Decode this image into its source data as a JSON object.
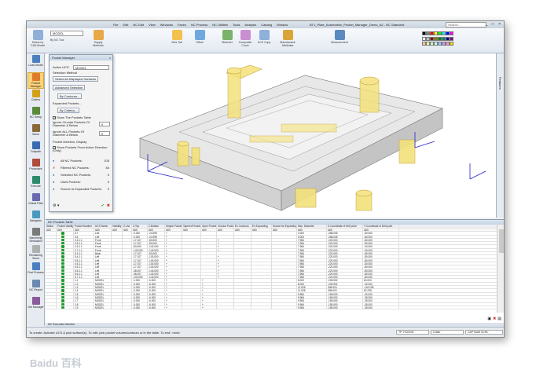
{
  "app": {
    "title": "BT1_Plate_Automation_Pocket_Manager_Demo_A2 - NC Standard",
    "menu": [
      "File",
      "Edit",
      "NC Edit",
      "View",
      "Windows",
      "Faces",
      "NC Process",
      "NC Utilities",
      "Tools",
      "Analysis",
      "Catalog",
      "Window"
    ],
    "search_placeholder": "Search...",
    "window_buttons": "_ □ ×",
    "model_combo": "MODEL"
  },
  "ribbon": {
    "select_by": "Select by\nCAD Model",
    "by_nc_tool": "By NC Tool",
    "supply_methods": "Supply Methods",
    "sets_tab": "Sets Tab",
    "offset": "Offset",
    "sketcher": "Sketcher",
    "composite_curve": "Composite Curve",
    "ucs_copy": "UCS Copy",
    "manufacture_attributes": "Manufacture Attributes",
    "measurement": "Measurement",
    "swatch_colors": [
      "#000000",
      "#7f7f7f",
      "#ff0000",
      "#ffff00",
      "#00ff00",
      "#00ffff",
      "#0000ff",
      "#ff00ff",
      "#ffffff",
      "#c0c0c0",
      "#800000",
      "#808000",
      "#008000",
      "#008080",
      "#000080",
      "#800080",
      "#ffcc99",
      "#ffff99",
      "#ccffcc",
      "#ccffff",
      "#99ccff",
      "#cc99ff",
      "#ff99cc",
      "#ffd700"
    ]
  },
  "left_toolbar": [
    {
      "label": "Load Model",
      "color": "#4a7fc0"
    },
    {
      "label": "Pocket Manager",
      "color": "#e07b2a",
      "active": true
    },
    {
      "label": "Cutters",
      "color": "#d4a017"
    },
    {
      "label": "NC Setup",
      "color": "#5a8a3a"
    },
    {
      "label": "Stock",
      "color": "#8a6a3a"
    },
    {
      "label": "Toolpath",
      "color": "#3a6ab0"
    },
    {
      "label": "Procedure",
      "color": "#b04a3a"
    },
    {
      "label": "Execute",
      "color": "#2a8a6a"
    },
    {
      "label": "Global Filter",
      "color": "#6a6ab0"
    },
    {
      "label": "Navigator",
      "color": "#4a9ac0"
    },
    {
      "label": "Machining Simulation",
      "color": "#7a7a7a"
    },
    {
      "label": "Remaining Stock",
      "color": "#b0b0b0"
    },
    {
      "label": "Post Process",
      "color": "#4a7fc0"
    },
    {
      "label": "NC Report",
      "color": "#6a8ab0"
    },
    {
      "label": "Job Manager",
      "color": "#8a5a9a"
    }
  ],
  "right_strip_label": "Features",
  "pocket_manager": {
    "title": "Pocket Manager",
    "active_ucs_label": "Active UCS:",
    "active_ucs_value": "MODEL",
    "selection_method": "Selection Method",
    "select_all_button": "Select All Displayed Surfaces",
    "advanced_button": "Advanced Selection",
    "by_contours_button": "By Contours...",
    "expanded_pockets": "Expanded Pockets...",
    "by_criteria_button": "By Criteria...",
    "show_pockets_table": "Show The Pockets Table",
    "ignore_circular": "Ignore Circular Pockets Of Diameter & Below",
    "ignore_circular_value": "0",
    "ignore_all": "Ignore ALL Pockets Of Diameter & Below",
    "ignore_all_value": "5",
    "pocket_deletion": "Pocket Deletion, Display",
    "show_from_direction": "Show Pockets From Active Direction (Only)",
    "counts": [
      {
        "label": "All NC Pockets:",
        "value": "105"
      },
      {
        "label": "Filtered NC Pockets:",
        "value": "84"
      },
      {
        "label": "Selected NC Pockets:",
        "value": "0"
      },
      {
        "label": "Used Pockets:",
        "value": "0"
      },
      {
        "label": "Source to Expanded Pockets:",
        "value": "0"
      }
    ]
  },
  "nc_table": {
    "title": "NC Pockets Table",
    "columns": [
      "Status",
      "Pocket Validity",
      "Pocket Number",
      "UCS Name",
      "Visibility",
      "Z-List",
      "Z-Top",
      "Z-Bottom",
      "Simple Pocket",
      "Tapered Pocket",
      "Open Pocket",
      "Circular Pocket",
      "Ex Contours",
      "Ex Expanding",
      "Source for Expanding",
      "Max. Diameter",
      "X-Coordinate of Drill point",
      "Y-Coordinate of Drill point"
    ],
    "filter": "(All)",
    "rows": [
      [
        "5.7",
        "Left",
        "",
        "",
        "-0.000",
        "-24.995",
        "+",
        "",
        "",
        "",
        "",
        "",
        "",
        "3.000",
        "-288.005",
        "-80.000"
      ],
      [
        "3.6",
        "Left",
        "",
        "",
        "-0.000",
        "-24.995",
        "+",
        "",
        "",
        "",
        "",
        "",
        "",
        "3.000",
        "-288.005",
        "-80.000"
      ],
      [
        "2.4.1.1",
        "Front",
        "",
        "",
        "-17.107",
        "-83.000",
        "+",
        "",
        "",
        "+",
        "",
        "",
        "",
        "7.984",
        "-220.000",
        "-80.000"
      ],
      [
        "2.5.1.1",
        "Front",
        "",
        "",
        "-17.107",
        "-83.000",
        "+",
        "",
        "",
        "+",
        "",
        "",
        "",
        "7.984",
        "-220.000",
        "-80.000"
      ],
      [
        "2.6.1.1",
        "Front",
        "",
        "",
        "-83.000",
        "-143.000",
        "+",
        "",
        "",
        "+",
        "",
        "",
        "",
        "7.984",
        "-220.000",
        "-30.000"
      ],
      [
        "2.7.1.1",
        "Front",
        "",
        "",
        "-143.000",
        "-143.000",
        "+",
        "",
        "",
        "+",
        "",
        "",
        "",
        "7.984",
        "-220.000",
        "-30.000"
      ],
      [
        "5.3.1.1",
        "Back",
        "",
        "",
        "-17.107",
        "-83.000",
        "+",
        "",
        "",
        "",
        "",
        "",
        "",
        "7.984",
        "-220.000",
        "-80.000"
      ],
      [
        "5.4.1.1",
        "Left",
        "",
        "",
        "-17.107",
        "-103.000",
        "+",
        "",
        "",
        "+",
        "",
        "",
        "",
        "7.984",
        "-220.000",
        "-80.000"
      ],
      [
        "5.5.1.1",
        "Left",
        "",
        "",
        "-17.107",
        "-103.000",
        "+",
        "",
        "",
        "+",
        "",
        "",
        "",
        "7.984",
        "-220.000",
        "-80.000"
      ],
      [
        "4.5.1.1",
        "Left",
        "",
        "",
        "-17.107",
        "-103.000",
        "+",
        "",
        "",
        "+",
        "",
        "",
        "",
        "7.984",
        "-220.000",
        "-80.000"
      ],
      [
        "6.5.1.1",
        "Left",
        "",
        "",
        "-17.107",
        "-103.000",
        "+",
        "",
        "",
        "+",
        "",
        "",
        "",
        "7.984",
        "-220.000",
        "-80.000"
      ],
      [
        "6.5.1.1",
        "Left",
        "",
        "",
        "-36.007",
        "-143.000",
        "+",
        "",
        "",
        "+",
        "",
        "",
        "",
        "7.984",
        "-220.000",
        "-80.000"
      ],
      [
        "6.6.1.1",
        "Left",
        "",
        "",
        "-36.007",
        "-143.000",
        "+",
        "",
        "",
        "+",
        "",
        "",
        "",
        "7.984",
        "-220.000",
        "-80.000"
      ],
      [
        "6.7.1.1",
        "Left",
        "",
        "",
        "-103.000",
        "-143.000",
        "+",
        "",
        "",
        "+",
        "",
        "",
        "",
        "7.984",
        "-220.000",
        "-80.000"
      ],
      [
        "1.1",
        "MODEL",
        "",
        "",
        "-0.000",
        "-6.000",
        "+",
        "",
        "+",
        "",
        "",
        "",
        "",
        "8.002",
        "-205.902",
        "60.000"
      ],
      [
        "1.2",
        "MODEL",
        "",
        "",
        "-0.000",
        "-6.000",
        "+",
        "",
        "+",
        "",
        "",
        "",
        "",
        "8.002",
        "-205.902",
        "-40.000"
      ],
      [
        "1.3",
        "MODEL",
        "",
        "",
        "-0.000",
        "-6.000",
        "+",
        "",
        "+",
        "",
        "",
        "",
        "",
        "11.525",
        "308.623",
        "-116.238"
      ],
      [
        "1.4",
        "MODEL",
        "",
        "",
        "-0.000",
        "-6.000",
        "+",
        "",
        "+",
        "",
        "",
        "",
        "",
        "11.525",
        "308.623",
        "62.238"
      ],
      [
        "1.5",
        "MODEL",
        "",
        "",
        "-0.000",
        "-6.000",
        "+",
        "",
        "+",
        "",
        "",
        "",
        "",
        "9.984",
        "-155.000",
        "-20.000"
      ],
      [
        "1.6",
        "MODEL",
        "",
        "",
        "-0.000",
        "-6.000",
        "+",
        "",
        "+",
        "",
        "",
        "",
        "",
        "9.984",
        "-155.000",
        "-35.000"
      ],
      [
        "1.7",
        "MODEL",
        "",
        "",
        "-0.000",
        "-6.000",
        "+",
        "",
        "+",
        "",
        "",
        "",
        "",
        "9.984",
        "-155.000",
        "-35.000"
      ],
      [
        "1.8",
        "MODEL",
        "",
        "",
        "-0.000",
        "-6.000",
        "+",
        "",
        "+",
        "",
        "",
        "",
        "",
        "9.984",
        "-155.000",
        "-35.000"
      ],
      [
        "1.9",
        "MODEL",
        "",
        "",
        "-0.000",
        "-6.000",
        "+",
        "",
        "+",
        "",
        "",
        "",
        "",
        "9.984",
        "-155.000",
        "-35.000"
      ]
    ]
  },
  "exec_monitor": "NC Execution Monitor",
  "status": {
    "prompt": "To create: Activate UCS & pick surface(s). To edit: pick pocket volume/contours or in the table. To end: <exit>",
    "mode": "TP: FACING",
    "object": "Cutter",
    "indicators": "CAP  NUM  SCRL"
  },
  "watermark": "Baidu 百科"
}
